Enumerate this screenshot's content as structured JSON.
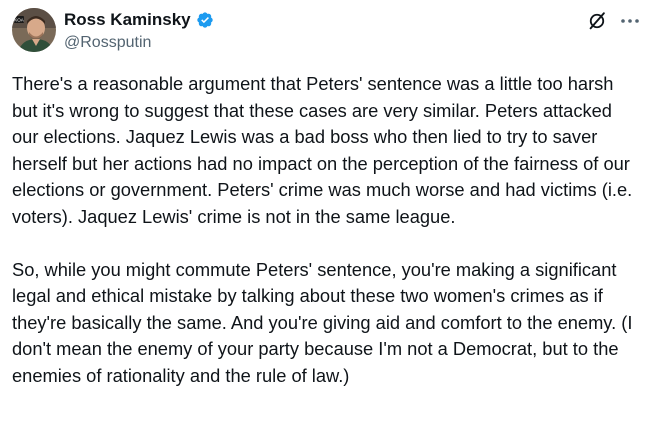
{
  "author": {
    "display_name": "Ross Kaminsky",
    "handle": "@Rossputin",
    "verified": true,
    "avatar_badge_text": "KOA"
  },
  "actions": {
    "grok_icon": "grok-slash-circle-icon",
    "more_icon": "more-horizontal-icon"
  },
  "post": {
    "paragraphs": [
      "There's a reasonable argument that Peters' sentence was a little too harsh but it's wrong to suggest that these cases are very similar. Peters attacked our elections. Jaquez Lewis was a bad boss who then lied to try to saver herself but her actions had no impact on the perception of the fairness of our elections or government. Peters' crime was much worse and had victims (i.e. voters). Jaquez Lewis' crime is not in the same league.",
      "So, while you might commute Peters' sentence, you're making a significant legal and ethical mistake by talking about these two women's crimes as if they're basically the same. And you're giving aid and comfort to the enemy. (I don't mean the enemy of your party because I'm not a Democrat, but to the enemies of rationality and the rule of law.)"
    ]
  },
  "colors": {
    "text_primary": "#0f1419",
    "text_secondary": "#536471",
    "verified_blue": "#1d9bf0",
    "background": "#ffffff"
  }
}
